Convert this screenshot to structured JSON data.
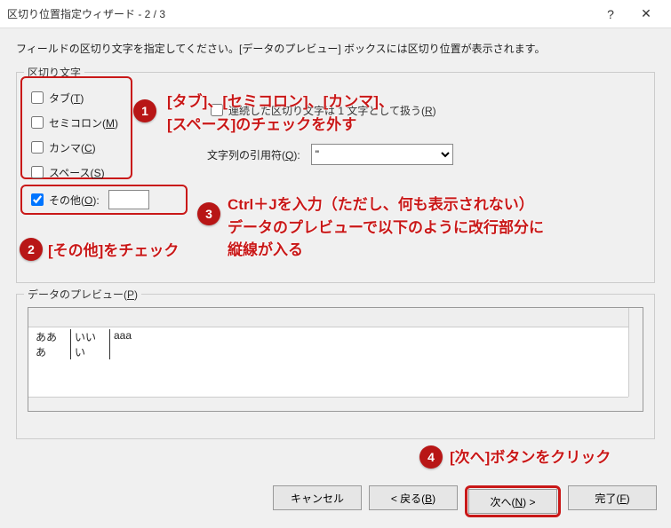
{
  "title": "区切り位置指定ウィザード - 2 / 3",
  "help_btn": "?",
  "close_btn": "✕",
  "instruction": "フィールドの区切り文字を指定してください。[データのプレビュー] ボックスには区切り位置が表示されます。",
  "group_delimiters": "区切り文字",
  "delimiters": {
    "tab": "タブ(T)",
    "semicolon": "セミコロン(M)",
    "comma": "カンマ(C)",
    "space": "スペース(S)",
    "other": "その他(O):",
    "other_checked": true,
    "other_value": ""
  },
  "consecutive_label": "連続した区切り文字は 1 文字として扱う(R)",
  "quote_label": "文字列の引用符(Q):",
  "quote_value": "\"",
  "group_preview": "データのプレビュー(P)",
  "preview": {
    "row": [
      "あああ",
      "いいい",
      "aaa"
    ]
  },
  "buttons": {
    "cancel": "キャンセル",
    "back": "< 戻る(B)",
    "next": "次へ(N) >",
    "finish": "完了(F)"
  },
  "annotations": {
    "b1": "1",
    "a1l1": "[タブ]、[セミコロン]、[カンマ]、",
    "a1l2": "[スペース]のチェックを外す",
    "b2": "2",
    "a2": "[その他]をチェック",
    "b3": "3",
    "a3l1": "Ctrl＋Jを入力（ただし、何も表示されない）",
    "a3l2": "データのプレビューで以下のように改行部分に",
    "a3l3": "縦線が入る",
    "b4": "4",
    "a4": "[次へ]ボタンをクリック"
  }
}
